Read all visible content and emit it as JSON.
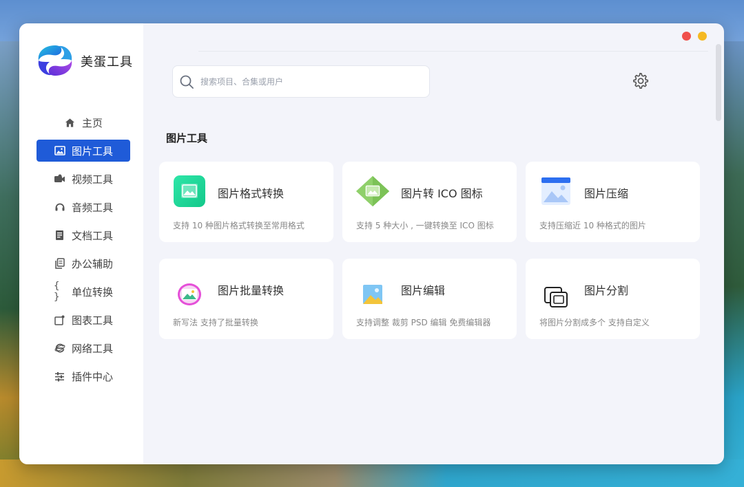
{
  "app": {
    "title": "美蛋工具"
  },
  "sidebar": {
    "items": [
      {
        "label": "主页",
        "icon": "home-icon",
        "active": false
      },
      {
        "label": "图片工具",
        "icon": "image-icon",
        "active": true
      },
      {
        "label": "视频工具",
        "icon": "video-icon",
        "active": false
      },
      {
        "label": "音频工具",
        "icon": "headphones-icon",
        "active": false
      },
      {
        "label": "文档工具",
        "icon": "document-icon",
        "active": false
      },
      {
        "label": "办公辅助",
        "icon": "clipboard-icon",
        "active": false
      },
      {
        "label": "单位转换",
        "icon": "braces-icon",
        "active": false
      },
      {
        "label": "图表工具",
        "icon": "chart-icon",
        "active": false
      },
      {
        "label": "网络工具",
        "icon": "browser-icon",
        "active": false
      },
      {
        "label": "插件中心",
        "icon": "sliders-icon",
        "active": false
      }
    ]
  },
  "search": {
    "placeholder": "搜索项目、合集或用户",
    "value": ""
  },
  "section": {
    "title": "图片工具"
  },
  "cards": [
    {
      "title": "图片格式转换",
      "desc": "支持 10 种图片格式转换至常用格式",
      "icon": "image-format-icon"
    },
    {
      "title": "图片转 ICO 图标",
      "desc": "支持 5 种大小 , 一键转换至 ICO 图标",
      "icon": "ico-convert-icon"
    },
    {
      "title": "图片压缩",
      "desc": "支持压缩近 10 种格式的图片",
      "icon": "image-compress-icon"
    },
    {
      "title": "图片批量转换",
      "desc": "新写法 支持了批量转换",
      "icon": "batch-convert-icon"
    },
    {
      "title": "图片编辑",
      "desc": "支持调整 裁剪 PSD 编辑  免费编辑器",
      "icon": "image-edit-icon"
    },
    {
      "title": "图片分割",
      "desc": "将图片分割成多个 支持自定义",
      "icon": "image-split-icon"
    }
  ],
  "colors": {
    "accent": "#1f5bd8",
    "window_bg": "#f3f4fa",
    "close": "#f0504c",
    "minimize": "#f5b922"
  }
}
